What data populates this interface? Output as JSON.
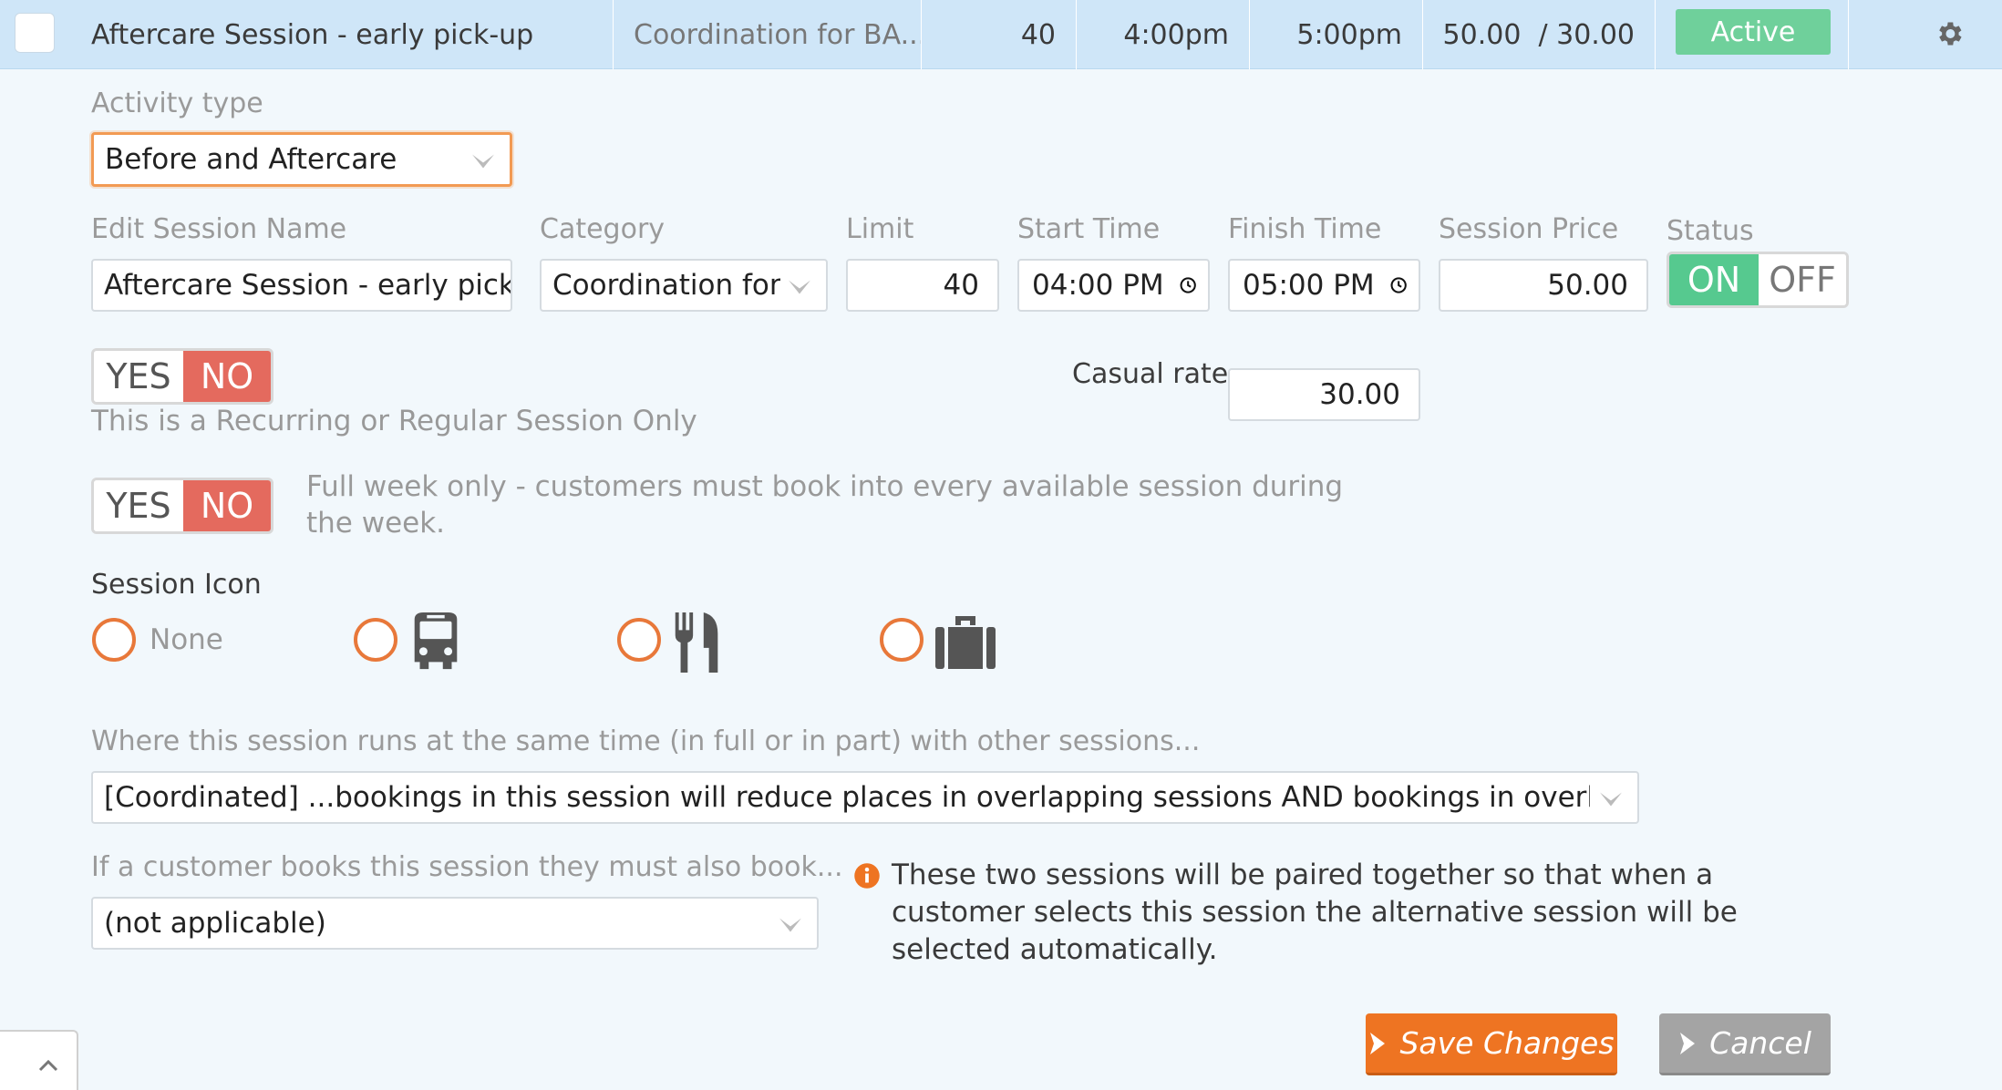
{
  "summary_row": {
    "session_name": "Aftercare Session - early pick-up",
    "category": "Coordination for BA...",
    "limit": "40",
    "start": "4:00pm",
    "finish": "5:00pm",
    "price": "50.00  / 30.00",
    "status": "Active"
  },
  "activity_type": {
    "label": "Activity type",
    "value": "Before and Aftercare"
  },
  "fields": {
    "session_name_label": "Edit Session Name",
    "session_name_value": "Aftercare Session - early pick-up",
    "category_label": "Category",
    "category_value": "Coordination for E",
    "limit_label": "Limit",
    "limit_value": "40",
    "start_label": "Start Time",
    "start_value": "04:00 PM",
    "finish_label": "Finish Time",
    "finish_value": "05:00 PM",
    "price_label": "Session Price",
    "price_value": "50.00",
    "status_label": "Status",
    "status_on": "ON",
    "status_off": "OFF",
    "casual_label": "Casual rate:",
    "casual_value": "30.00"
  },
  "recurring": {
    "yes": "YES",
    "no": "NO",
    "description": "This is a Recurring or Regular Session Only"
  },
  "full_week": {
    "yes": "YES",
    "no": "NO",
    "description_line1": "Full week only - customers must book into every available session during",
    "description_line2": "the week."
  },
  "session_icon": {
    "label": "Session Icon",
    "none_label": "None",
    "options": [
      "none",
      "bus-icon",
      "cutlery-icon",
      "briefcase-icon"
    ]
  },
  "overlap": {
    "label": "Where this session runs at the same time (in full or in part) with other sessions...",
    "value": "[Coordinated] ...bookings in this session will reduce places in overlapping sessions AND bookings in overlapping sessions w"
  },
  "pairing": {
    "label": "If a customer books this session they must also book...",
    "value": "(not applicable)",
    "info_line1": "These two sessions will be paired together so that when a",
    "info_line2": "customer selects this session the alternative session will be",
    "info_line3": "selected automatically."
  },
  "buttons": {
    "save": "Save Changes",
    "cancel": "Cancel"
  },
  "colors": {
    "accent_orange": "#ee7422",
    "active_green": "#6fd09b",
    "toggle_no_red": "#e46a5e",
    "toggle_on_green": "#56c98f",
    "row_blue": "#cfe6f8"
  }
}
